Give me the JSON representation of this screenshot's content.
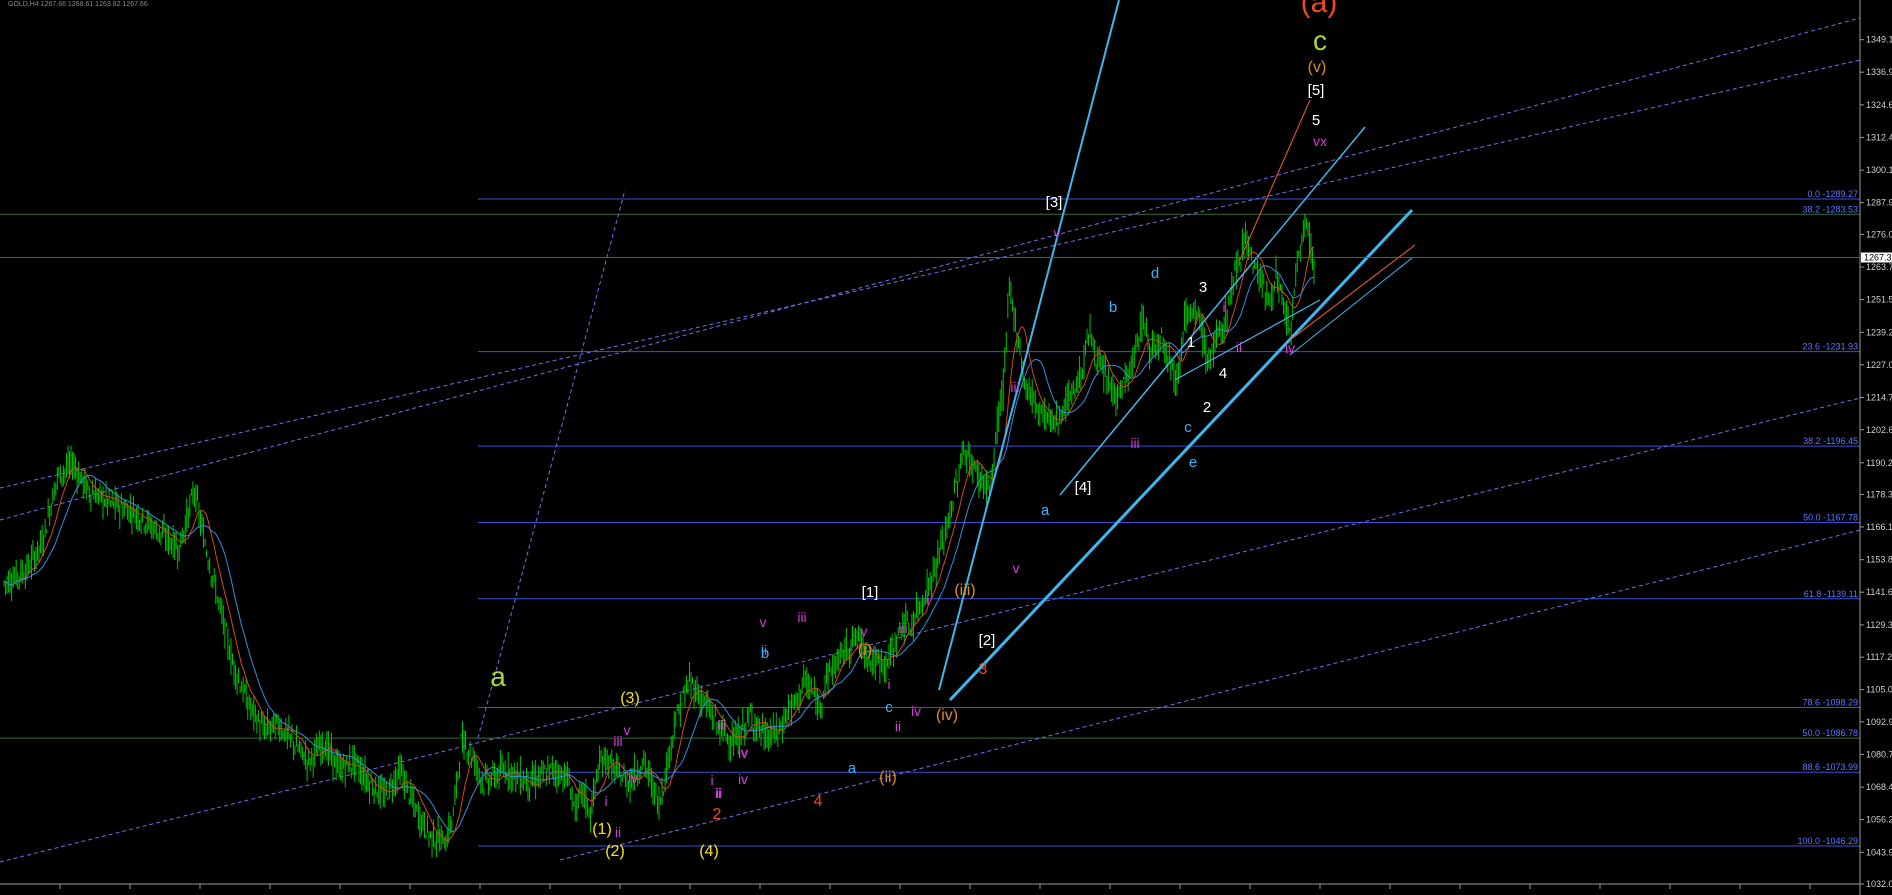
{
  "colors": {
    "background": "#000000",
    "candles": "#00c400",
    "ma_fast": "#d24a1a",
    "ma_slow": "#2f8fe0",
    "fib_lines": "#3c50dc",
    "trend_solid": "#3db8ee",
    "channel_dashed": "#6b72e6",
    "orange_trendline": "#d8502a",
    "price_tag_bg": "#ffffff",
    "wave_white": "#ffffff",
    "wave_yellow": "#f5e40c",
    "wave_magenta": "#d63adf",
    "wave_orange": "#e08a24",
    "wave_red": "#f04a18",
    "wave_cyan": "#39b4ff",
    "wave_lime": "#a8d83a"
  },
  "header": {
    "caption": "GOLD,H4  1267.66 1268.61 1263.82 1267.66"
  },
  "chart_data": {
    "type": "candlestick",
    "title": "",
    "xlabel": "",
    "ylabel": "",
    "ylim": [
      1032.0,
      1361.0
    ],
    "grid": false,
    "y_ticks": [
      "1349.1",
      "1336.9",
      "1324.6",
      "1312.4",
      "1300.1",
      "1287.9",
      "1276.0",
      "1263.7",
      "1251.5",
      "1239.2",
      "1227.0",
      "1214.7",
      "1202.6",
      "1190.2",
      "1178.3",
      "1166.1",
      "1153.8",
      "1141.6",
      "1129.3",
      "1117.2",
      "1105.0",
      "1092.9",
      "1080.7",
      "1068.4",
      "1056.2",
      "1043.9",
      "1032.0"
    ],
    "current_price": "1267.3",
    "price_path": [
      [
        0,
        1145
      ],
      [
        15,
        1150
      ],
      [
        25,
        1160
      ],
      [
        35,
        1185
      ],
      [
        45,
        1190
      ],
      [
        55,
        1180
      ],
      [
        70,
        1175
      ],
      [
        85,
        1172
      ],
      [
        100,
        1165
      ],
      [
        115,
        1158
      ],
      [
        125,
        1180
      ],
      [
        130,
        1165
      ],
      [
        140,
        1140
      ],
      [
        150,
        1115
      ],
      [
        160,
        1100
      ],
      [
        170,
        1090
      ],
      [
        180,
        1092
      ],
      [
        190,
        1085
      ],
      [
        200,
        1078
      ],
      [
        210,
        1085
      ],
      [
        220,
        1075
      ],
      [
        230,
        1078
      ],
      [
        240,
        1070
      ],
      [
        250,
        1065
      ],
      [
        260,
        1075
      ],
      [
        270,
        1060
      ],
      [
        280,
        1050
      ],
      [
        290,
        1048
      ],
      [
        295,
        1058
      ],
      [
        300,
        1085
      ],
      [
        305,
        1083
      ],
      [
        315,
        1070
      ],
      [
        330,
        1075
      ],
      [
        345,
        1070
      ],
      [
        360,
        1075
      ],
      [
        370,
        1072
      ],
      [
        375,
        1060
      ],
      [
        380,
        1067
      ],
      [
        385,
        1058
      ],
      [
        390,
        1075
      ],
      [
        395,
        1080
      ],
      [
        400,
        1075
      ],
      [
        410,
        1070
      ],
      [
        420,
        1078
      ],
      [
        425,
        1070
      ],
      [
        430,
        1062
      ],
      [
        435,
        1075
      ],
      [
        440,
        1092
      ],
      [
        450,
        1108
      ],
      [
        460,
        1100
      ],
      [
        470,
        1090
      ],
      [
        480,
        1085
      ],
      [
        490,
        1095
      ],
      [
        500,
        1087
      ],
      [
        510,
        1090
      ],
      [
        515,
        1098
      ],
      [
        520,
        1100
      ],
      [
        525,
        1108
      ],
      [
        530,
        1105
      ],
      [
        535,
        1098
      ],
      [
        540,
        1110
      ],
      [
        550,
        1118
      ],
      [
        560,
        1125
      ],
      [
        570,
        1115
      ],
      [
        580,
        1115
      ],
      [
        590,
        1130
      ],
      [
        595,
        1128
      ],
      [
        600,
        1135
      ],
      [
        610,
        1148
      ],
      [
        620,
        1168
      ],
      [
        630,
        1195
      ],
      [
        640,
        1185
      ],
      [
        648,
        1180
      ],
      [
        652,
        1205
      ],
      [
        656,
        1218
      ],
      [
        660,
        1255
      ],
      [
        665,
        1240
      ],
      [
        670,
        1220
      ],
      [
        680,
        1210
      ],
      [
        690,
        1205
      ],
      [
        700,
        1215
      ],
      [
        708,
        1225
      ],
      [
        712,
        1240
      ],
      [
        720,
        1225
      ],
      [
        725,
        1220
      ],
      [
        730,
        1215
      ],
      [
        740,
        1225
      ],
      [
        748,
        1245
      ],
      [
        752,
        1232
      ],
      [
        760,
        1238
      ],
      [
        765,
        1230
      ],
      [
        770,
        1220
      ],
      [
        775,
        1245
      ],
      [
        785,
        1245
      ],
      [
        790,
        1228
      ],
      [
        795,
        1235
      ],
      [
        800,
        1240
      ],
      [
        810,
        1265
      ],
      [
        815,
        1276
      ],
      [
        820,
        1265
      ],
      [
        825,
        1260
      ],
      [
        830,
        1250
      ],
      [
        835,
        1260
      ],
      [
        840,
        1248
      ],
      [
        845,
        1240
      ],
      [
        850,
        1270
      ],
      [
        855,
        1280
      ],
      [
        860,
        1265
      ]
    ],
    "fib_levels": [
      {
        "label": "0.0 -1289.27",
        "value": 1289.27
      },
      {
        "label": "38.2 -1283.53",
        "value": 1283.53
      },
      {
        "label": "23.6 -1231.93",
        "value": 1231.93
      },
      {
        "label": "38.2 -1196.45",
        "value": 1196.45
      },
      {
        "label": "50.0 -1167.78",
        "value": 1167.78
      },
      {
        "label": "61.8 -1139.11",
        "value": 1139.11
      },
      {
        "label": "78.6 -1098.29",
        "value": 1098.29
      },
      {
        "label": "50.0 -1086.78",
        "value": 1086.78
      },
      {
        "label": "88.6 -1073.99",
        "value": 1073.99
      },
      {
        "label": "100.0 -1046.29",
        "value": 1046.29
      }
    ],
    "wave_labels": [
      {
        "text": "(a)",
        "color": "wave_red",
        "size": 30
      },
      {
        "text": "c",
        "color": "wave_lime",
        "size": 28
      },
      {
        "text": "(v)",
        "color": "wave_orange",
        "size": 16
      },
      {
        "text": "[5]",
        "color": "wave_white",
        "size": 15
      },
      {
        "text": "5",
        "color": "wave_white",
        "size": 15
      },
      {
        "text": "vx",
        "color": "wave_magenta",
        "size": 14
      },
      {
        "text": "[3]",
        "color": "wave_white",
        "size": 15
      },
      {
        "text": "v",
        "color": "wave_magenta",
        "size": 14
      },
      {
        "text": "iii",
        "color": "wave_magenta",
        "size": 14
      },
      {
        "text": "d",
        "color": "wave_cyan",
        "size": 15
      },
      {
        "text": "b",
        "color": "wave_cyan",
        "size": 15
      },
      {
        "text": "3",
        "color": "wave_white",
        "size": 15
      },
      {
        "text": "i",
        "color": "wave_magenta",
        "size": 14
      },
      {
        "text": "1",
        "color": "wave_white",
        "size": 15
      },
      {
        "text": "ii",
        "color": "wave_magenta",
        "size": 14
      },
      {
        "text": "iv",
        "color": "wave_magenta",
        "size": 14
      },
      {
        "text": "4",
        "color": "wave_white",
        "size": 15
      },
      {
        "text": "2",
        "color": "wave_white",
        "size": 15
      },
      {
        "text": "iii",
        "color": "wave_magenta",
        "size": 14
      },
      {
        "text": "c",
        "color": "wave_cyan",
        "size": 15
      },
      {
        "text": "e",
        "color": "wave_cyan",
        "size": 15
      },
      {
        "text": "[4]",
        "color": "wave_white",
        "size": 15
      },
      {
        "text": "a",
        "color": "wave_cyan",
        "size": 15
      },
      {
        "text": "v",
        "color": "wave_magenta",
        "size": 14
      },
      {
        "text": "i",
        "color": "wave_magenta",
        "size": 14
      },
      {
        "text": "(iii)",
        "color": "wave_orange",
        "size": 16
      },
      {
        "text": "[1]",
        "color": "wave_white",
        "size": 15
      },
      {
        "text": "v",
        "color": "wave_magenta",
        "size": 14
      },
      {
        "text": "iii",
        "color": "wave_magenta",
        "size": 14
      },
      {
        "text": "ii",
        "color": "wave_magenta",
        "size": 14
      },
      {
        "text": "[2]",
        "color": "wave_white",
        "size": 15
      },
      {
        "text": "3",
        "color": "wave_red",
        "size": 16
      },
      {
        "text": "v",
        "color": "wave_magenta",
        "size": 14
      },
      {
        "text": "b",
        "color": "wave_cyan",
        "size": 15
      },
      {
        "text": "(i)",
        "color": "wave_orange",
        "size": 16
      },
      {
        "text": "i",
        "color": "wave_magenta",
        "size": 14
      },
      {
        "text": "iii",
        "color": "wave_magenta",
        "size": 14
      },
      {
        "text": "iv",
        "color": "wave_magenta",
        "size": 14
      },
      {
        "text": "(iv)",
        "color": "wave_orange",
        "size": 16
      },
      {
        "text": "c",
        "color": "wave_cyan",
        "size": 15
      },
      {
        "text": "ii",
        "color": "wave_magenta",
        "size": 14
      },
      {
        "text": "a",
        "color": "wave_cyan",
        "size": 15
      },
      {
        "text": "(ii)",
        "color": "wave_orange",
        "size": 16
      },
      {
        "text": "iv",
        "color": "wave_magenta",
        "size": 14
      },
      {
        "text": "4",
        "color": "wave_red",
        "size": 16
      },
      {
        "text": "a",
        "color": "wave_lime",
        "size": 28
      },
      {
        "text": "(3)",
        "color": "wave_yellow",
        "size": 16
      },
      {
        "text": "v",
        "color": "wave_magenta",
        "size": 14
      },
      {
        "text": "iii",
        "color": "wave_magenta",
        "size": 14
      },
      {
        "text": "iv",
        "color": "wave_magenta",
        "size": 14
      },
      {
        "text": "i",
        "color": "wave_magenta",
        "size": 14
      },
      {
        "text": "ii",
        "color": "wave_magenta",
        "size": 14
      },
      {
        "text": "(1)",
        "color": "wave_yellow",
        "size": 16
      },
      {
        "text": "(2)",
        "color": "wave_yellow",
        "size": 16
      },
      {
        "text": "i",
        "color": "wave_magenta",
        "size": 14
      },
      {
        "text": "iv",
        "color": "wave_magenta",
        "size": 14
      },
      {
        "text": "ii",
        "color": "wave_magenta",
        "size": 14
      },
      {
        "text": "2",
        "color": "wave_red",
        "size": 16
      },
      {
        "text": "(4)",
        "color": "wave_yellow",
        "size": 16
      },
      {
        "text": "iii",
        "color": "wave_magenta",
        "size": 14
      },
      {
        "text": "ii",
        "color": "wave_magenta",
        "size": 14
      },
      {
        "text": "iv",
        "color": "wave_magenta",
        "size": 14
      }
    ]
  }
}
